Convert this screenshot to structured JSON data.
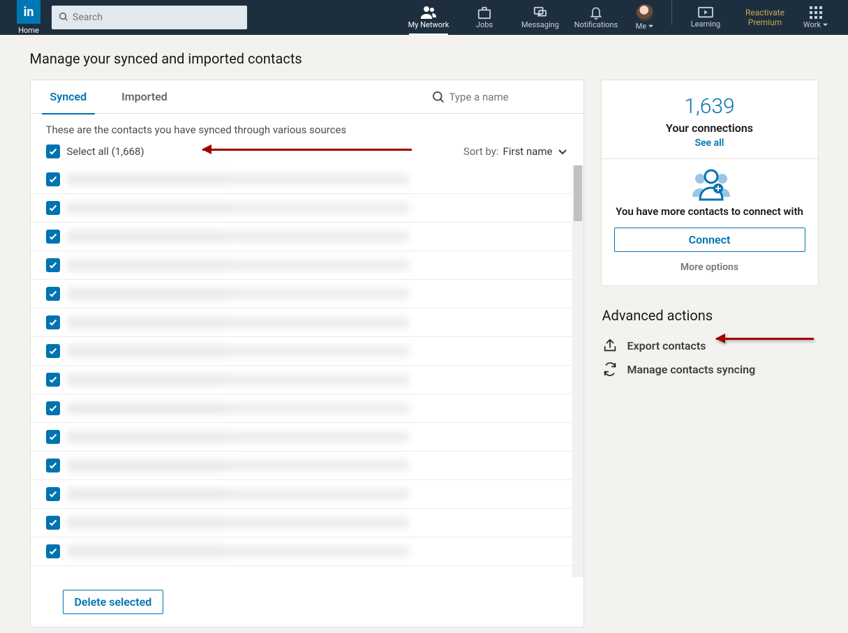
{
  "nav": {
    "home": "Home",
    "search_placeholder": "Search",
    "items": {
      "network": "My Network",
      "jobs": "Jobs",
      "messaging": "Messaging",
      "notifications": "Notifications",
      "me": "Me",
      "learning": "Learning",
      "work": "Work"
    },
    "premium_l1": "Reactivate",
    "premium_l2": "Premium"
  },
  "page_title": "Manage your synced and imported contacts",
  "tabs": {
    "synced": "Synced",
    "imported": "Imported",
    "search_placeholder": "Type a name"
  },
  "list": {
    "description": "These are the contacts you have synced through various sources",
    "select_all_label": "Select all (1,668)",
    "sort_label": "Sort by:",
    "sort_value": "First name",
    "rows": [
      {
        "n": "",
        "e": ""
      },
      {
        "n": "",
        "e": ""
      },
      {
        "n": "",
        "e": ""
      },
      {
        "n": "",
        "e": ""
      },
      {
        "n": "",
        "e": ""
      },
      {
        "n": "",
        "e": ""
      },
      {
        "n": "",
        "e": ""
      },
      {
        "n": "",
        "e": ""
      },
      {
        "n": "",
        "e": ""
      },
      {
        "n": "",
        "e": ""
      },
      {
        "n": "",
        "e": ""
      },
      {
        "n": "",
        "e": ""
      },
      {
        "n": "",
        "e": ""
      },
      {
        "n": "",
        "e": ""
      }
    ],
    "delete_label": "Delete selected"
  },
  "side": {
    "connections_count": "1,639",
    "connections_label": "Your connections",
    "see_all": "See all",
    "more_contacts_msg": "You have more contacts to connect with",
    "connect_btn": "Connect",
    "more_options": "More options",
    "advanced_header": "Advanced actions",
    "export_label": "Export contacts",
    "sync_label": "Manage contacts syncing"
  }
}
